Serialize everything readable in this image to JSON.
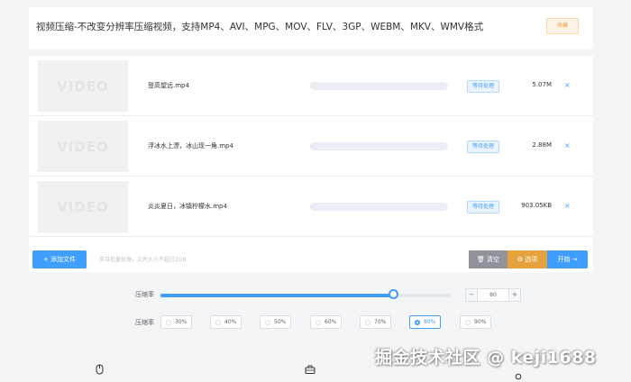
{
  "header": {
    "title": "视频压缩-不改变分辨率压缩视频，支持MP4、AVI、MPG、MOV、FLV、3GP、WEBM、MKV、WMV格式",
    "favorite_label": "收藏"
  },
  "files": [
    {
      "thumb_text": "VIDEO",
      "name": "登高望远.mp4",
      "progress": 0,
      "status": "等待处理",
      "size": "5.07M",
      "remove": "×"
    },
    {
      "thumb_text": "VIDEO",
      "name": "浮冰水上漂，冰山现一角.mp4",
      "progress": 0,
      "status": "等待处理",
      "size": "2.88M",
      "remove": "×"
    },
    {
      "thumb_text": "VIDEO",
      "name": "炎炎夏日，冰镇柠檬水.mp4",
      "progress": 0,
      "status": "等待处理",
      "size": "903.05KB",
      "remove": "×"
    }
  ],
  "toolbar": {
    "add_label": "+ 添加文件",
    "hint": "支持批量处理，文件大小不超过2GB",
    "clear_label": "🗑 清空",
    "options_label": "⚙ 选项",
    "start_label": "开始 →"
  },
  "compression": {
    "label": "压缩率",
    "value": 80,
    "value_text": "80",
    "minus": "−",
    "plus": "+",
    "slider_percent": 80,
    "presets_label": "压缩率",
    "presets": [
      "30%",
      "40%",
      "50%",
      "60%",
      "70%",
      "80%",
      "90%"
    ],
    "selected_preset": "80%"
  },
  "watermark": "掘金技术社区 @ keji1688",
  "colors": {
    "primary": "#409eff",
    "warning": "#e6a23c",
    "info": "#909399"
  }
}
